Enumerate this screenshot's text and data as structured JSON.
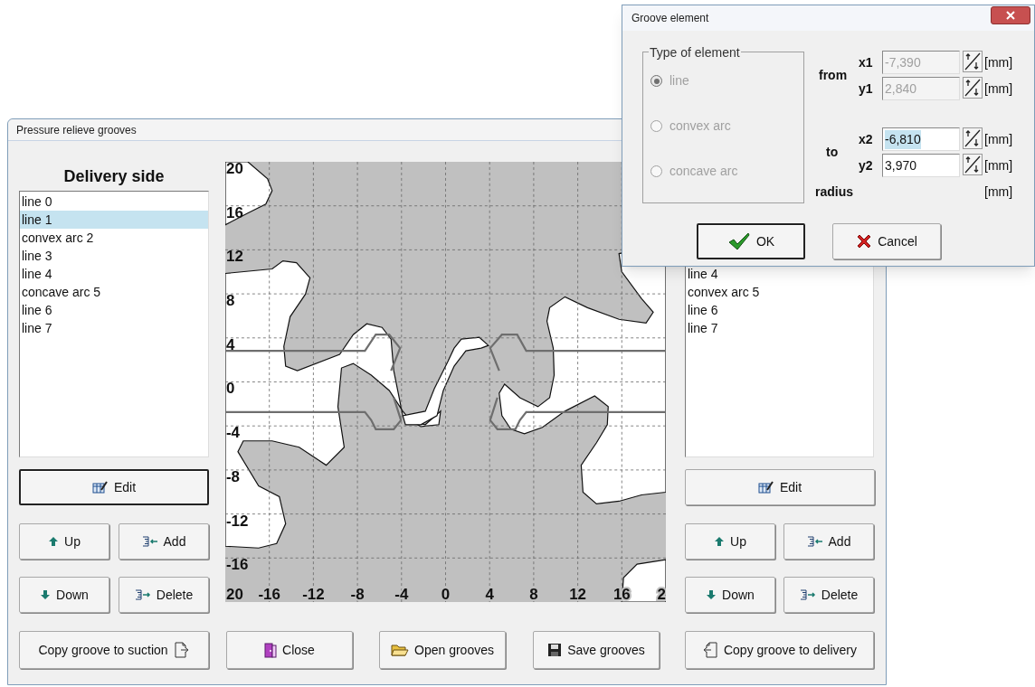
{
  "main_window": {
    "title": "Pressure relieve grooves",
    "delivery": {
      "heading": "Delivery side",
      "items": [
        {
          "label": "line 0",
          "selected": false
        },
        {
          "label": "line 1",
          "selected": true
        },
        {
          "label": "convex arc 2",
          "selected": false
        },
        {
          "label": "line 3",
          "selected": false
        },
        {
          "label": "line 4",
          "selected": false
        },
        {
          "label": "concave arc 5",
          "selected": false
        },
        {
          "label": "line 6",
          "selected": false
        },
        {
          "label": "line 7",
          "selected": false
        }
      ],
      "buttons": [
        {
          "label": "Edit",
          "kind": "edit",
          "default": true
        },
        {
          "label": "Up",
          "kind": "up",
          "default": false
        },
        {
          "label": "Add",
          "kind": "add",
          "default": false
        },
        {
          "label": "Down",
          "kind": "down",
          "default": false
        },
        {
          "label": "Delete",
          "kind": "delete",
          "default": false
        }
      ]
    },
    "plot": {
      "yticks": [
        "20",
        "16",
        "12",
        "8",
        "4",
        "0",
        "-4",
        "-8",
        "-12",
        "-16"
      ],
      "xticks": [
        "20",
        "-16",
        "-12",
        "-8",
        "-4",
        "0",
        "4",
        "8",
        "12",
        "16",
        "2"
      ]
    },
    "suction": {
      "items": [
        {
          "label": "line 4",
          "selected": false
        },
        {
          "label": "convex arc 5",
          "selected": false
        },
        {
          "label": "line 6",
          "selected": false
        },
        {
          "label": "line 7",
          "selected": false
        }
      ],
      "buttons": [
        {
          "label": "Edit",
          "kind": "edit",
          "default": false
        },
        {
          "label": "Up",
          "kind": "up",
          "default": false
        },
        {
          "label": "Add",
          "kind": "add",
          "default": false
        },
        {
          "label": "Down",
          "kind": "down",
          "default": false
        },
        {
          "label": "Delete",
          "kind": "delete",
          "default": false
        }
      ]
    },
    "bottom_buttons": [
      {
        "label": "Copy groove to suction",
        "kind": "copyright"
      },
      {
        "label": "Close",
        "kind": "close"
      },
      {
        "label": "Open grooves",
        "kind": "open"
      },
      {
        "label": "Save grooves",
        "kind": "save"
      },
      {
        "label": "Copy groove to delivery",
        "kind": "copyleft"
      }
    ]
  },
  "dialog": {
    "title": "Groove element",
    "type_group": {
      "title": "Type of element",
      "disabled": true,
      "options": [
        {
          "label": "line",
          "selected": true
        },
        {
          "label": "convex arc",
          "selected": false
        },
        {
          "label": "concave arc",
          "selected": false
        }
      ]
    },
    "from_label": "from",
    "to_label": "to",
    "fields": [
      {
        "label": "x1",
        "value": "-7,390",
        "unit": "[mm]",
        "disabled": true,
        "highlighted": false
      },
      {
        "label": "y1",
        "value": "2,840",
        "unit": "[mm]",
        "disabled": true,
        "highlighted": false
      },
      {
        "label": "x2",
        "value": "-6,810",
        "unit": "[mm]",
        "disabled": false,
        "highlighted": true
      },
      {
        "label": "y2",
        "value": "3,970",
        "unit": "[mm]",
        "disabled": false,
        "highlighted": false
      }
    ],
    "radius": {
      "label": "radius",
      "unit": "[mm]"
    },
    "buttons": [
      {
        "label": "OK",
        "kind": "ok",
        "default": true
      },
      {
        "label": "Cancel",
        "kind": "cancel",
        "default": false
      }
    ]
  }
}
